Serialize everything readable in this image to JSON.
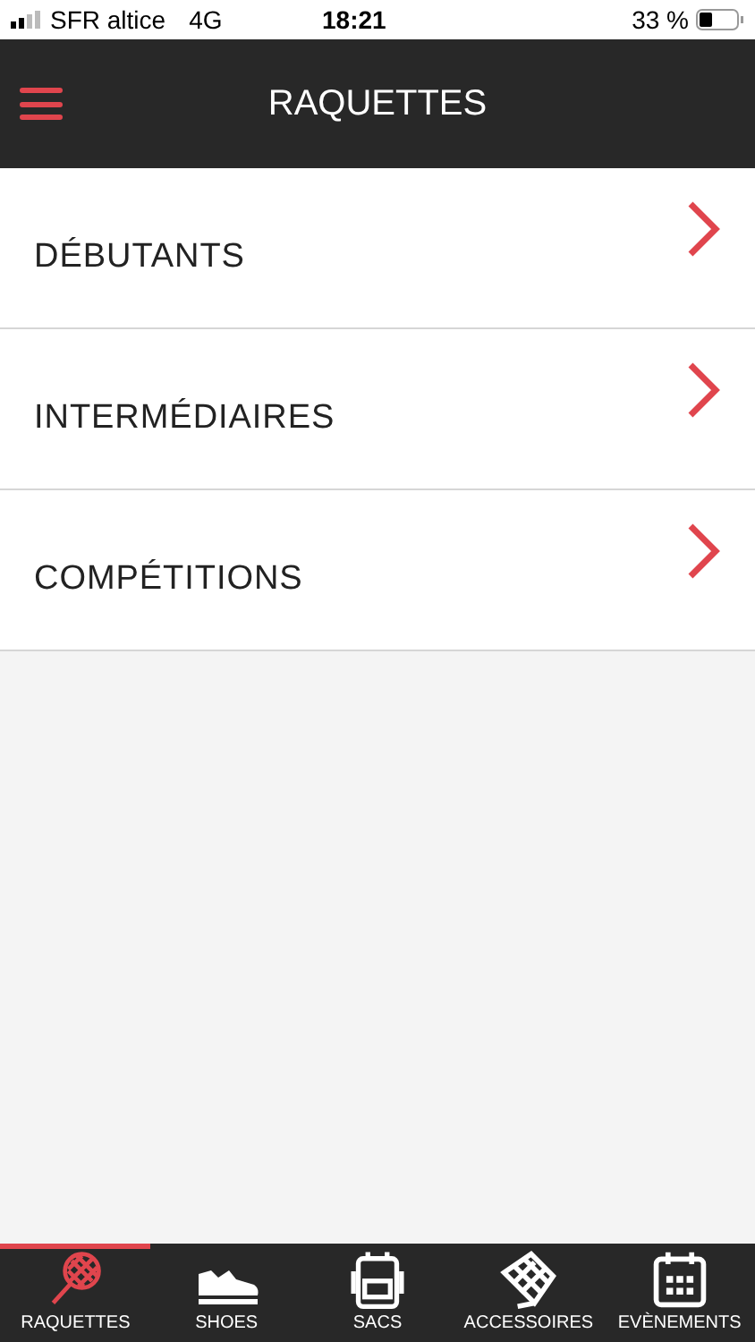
{
  "status_bar": {
    "carrier": "SFR altice",
    "network": "4G",
    "time": "18:21",
    "battery": "33 %"
  },
  "header": {
    "title": "RAQUETTES"
  },
  "categories": [
    {
      "label": "DÉBUTANTS"
    },
    {
      "label": "INTERMÉDIAIRES"
    },
    {
      "label": "COMPÉTITIONS"
    }
  ],
  "tabs": [
    {
      "label": "RAQUETTES",
      "selected": true
    },
    {
      "label": "SHOES",
      "selected": false
    },
    {
      "label": "SACS",
      "selected": false
    },
    {
      "label": "ACCESSOIRES",
      "selected": false
    },
    {
      "label": "EVÈNEMENTS",
      "selected": false
    }
  ]
}
